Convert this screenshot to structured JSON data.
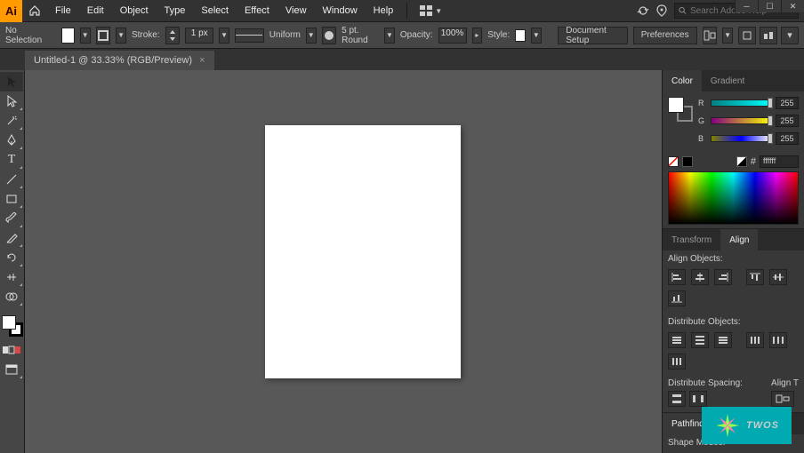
{
  "menubar": {
    "logo": "Ai",
    "items": [
      "File",
      "Edit",
      "Object",
      "Type",
      "Select",
      "Effect",
      "View",
      "Window",
      "Help"
    ],
    "search_placeholder": "Search Adobe Help"
  },
  "controlbar": {
    "selection_label": "No Selection",
    "stroke_label": "Stroke:",
    "stroke_weight": "1 px",
    "profile_label": "Uniform",
    "brush_label": "5 pt. Round",
    "opacity_label": "Opacity:",
    "opacity_value": "100%",
    "style_label": "Style:",
    "doc_setup": "Document Setup",
    "preferences": "Preferences"
  },
  "tab": {
    "title": "Untitled-1 @ 33.33% (RGB/Preview)",
    "close": "×"
  },
  "color_panel": {
    "tab_color": "Color",
    "tab_gradient": "Gradient",
    "r_label": "R",
    "g_label": "G",
    "b_label": "B",
    "r_value": "255",
    "g_value": "255",
    "b_value": "255",
    "hex_prefix": "#",
    "hex_value": "ffffff"
  },
  "align_panel": {
    "tab_transform": "Transform",
    "tab_align": "Align",
    "align_objects": "Align Objects:",
    "distribute_objects": "Distribute Objects:",
    "distribute_spacing": "Distribute Spacing:",
    "align_to": "Align T"
  },
  "pathfinder_panel": {
    "tab": "Pathfinder",
    "shape_modes": "Shape Modes:"
  },
  "badge": "TWOS"
}
